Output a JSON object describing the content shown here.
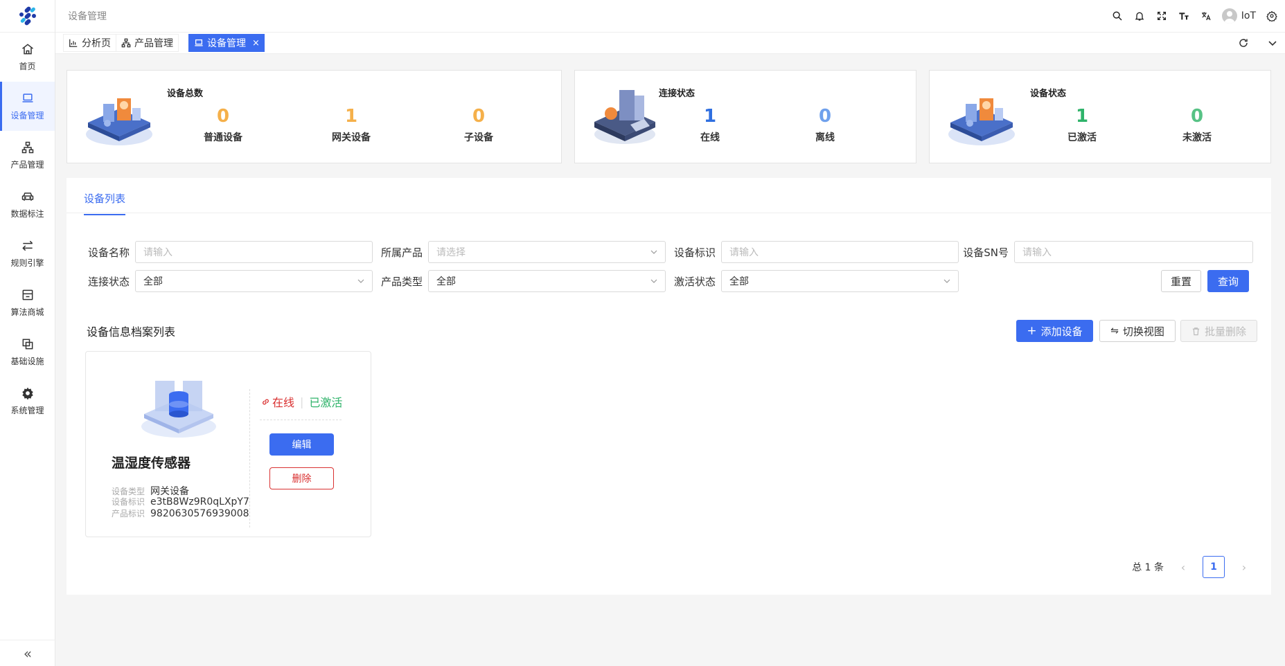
{
  "header": {
    "title": "设备管理",
    "user": "IoT"
  },
  "sidebar": {
    "items": [
      {
        "label": "首页",
        "icon": "home-icon"
      },
      {
        "label": "设备管理",
        "icon": "laptop-icon",
        "active": true
      },
      {
        "label": "产品管理",
        "icon": "sitemap-icon"
      },
      {
        "label": "数据标注",
        "icon": "car-icon"
      },
      {
        "label": "规则引擎",
        "icon": "swap-icon"
      },
      {
        "label": "算法商城",
        "icon": "store-icon"
      },
      {
        "label": "基础设施",
        "icon": "layers-icon"
      },
      {
        "label": "系统管理",
        "icon": "gear-icon"
      }
    ],
    "collapse": "«"
  },
  "tabs": [
    {
      "label": "分析页",
      "icon": "bar-chart-icon"
    },
    {
      "label": "产品管理",
      "icon": "sitemap-icon"
    },
    {
      "label": "设备管理",
      "icon": "laptop-icon",
      "active": true,
      "close": "×"
    }
  ],
  "stats": {
    "total": {
      "title": "设备总数",
      "items": [
        {
          "value": "0",
          "label": "普通设备"
        },
        {
          "value": "1",
          "label": "网关设备"
        },
        {
          "value": "0",
          "label": "子设备"
        }
      ]
    },
    "connection": {
      "title": "连接状态",
      "items": [
        {
          "value": "1",
          "label": "在线"
        },
        {
          "value": "0",
          "label": "离线"
        }
      ]
    },
    "device_status": {
      "title": "设备状态",
      "items": [
        {
          "value": "1",
          "label": "已激活"
        },
        {
          "value": "0",
          "label": "未激活"
        }
      ]
    }
  },
  "colors": {
    "accent": "#3b6cf0",
    "orange": "#f5b04a",
    "blue_stat": "#2f6fe0",
    "green": "#2fb36a",
    "danger": "#d93030"
  },
  "panel": {
    "tab": "设备列表",
    "filters": {
      "device_name": {
        "label": "设备名称",
        "placeholder": "请输入"
      },
      "product": {
        "label": "所属产品",
        "placeholder": "请选择"
      },
      "device_key": {
        "label": "设备标识",
        "placeholder": "请输入"
      },
      "device_sn": {
        "label": "设备SN号",
        "placeholder": "请输入"
      },
      "conn_status": {
        "label": "连接状态",
        "value": "全部"
      },
      "product_type": {
        "label": "产品类型",
        "value": "全部"
      },
      "activate_status": {
        "label": "激活状态",
        "value": "全部"
      }
    },
    "reset": "重置",
    "query": "查询",
    "list_title": "设备信息档案列表",
    "add": "添加设备",
    "switch_view": "切换视图",
    "batch_delete": "批量删除",
    "card": {
      "name": "温湿度传感器",
      "online": "在线",
      "activated": "已激活",
      "edit": "编辑",
      "delete": "删除",
      "meta": [
        {
          "k": "设备类型",
          "v": "网关设备"
        },
        {
          "k": "设备标识",
          "v": "e3tB8Wz9R0qLXpY7"
        },
        {
          "k": "产品标识",
          "v": "9820630576939008"
        }
      ]
    },
    "pagination": {
      "total": "总 1 条",
      "page": "1"
    }
  }
}
